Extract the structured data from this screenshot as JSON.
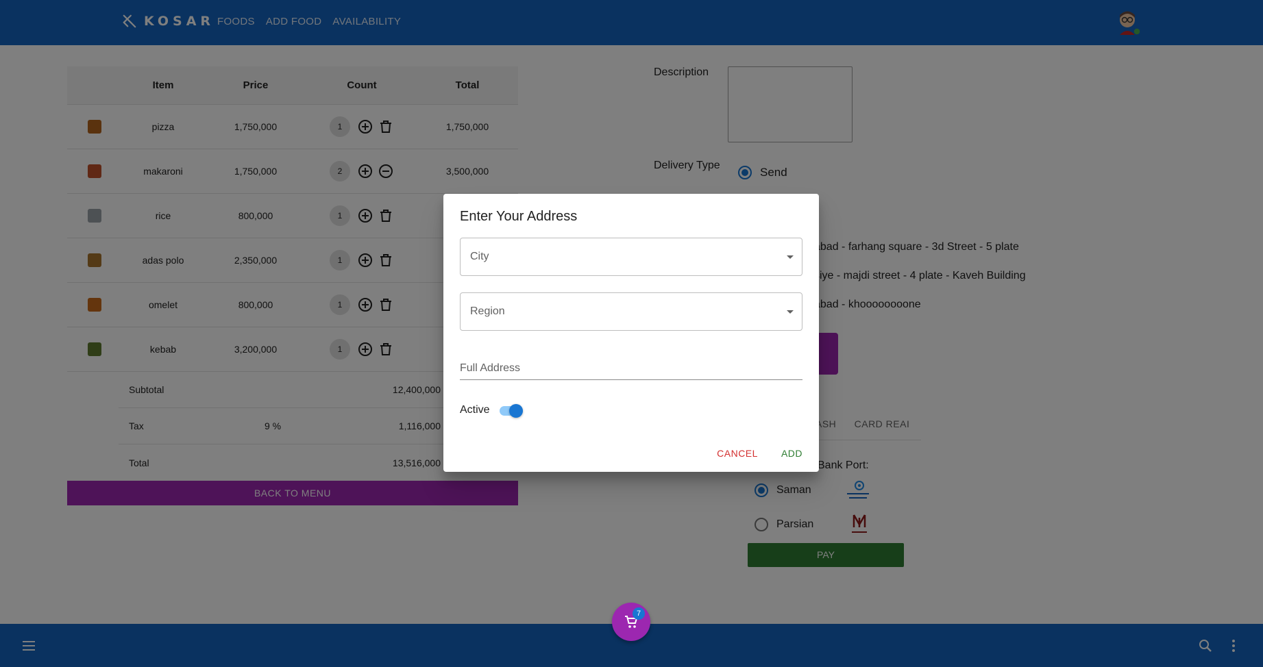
{
  "app": {
    "brand": "KOSAR",
    "nav": [
      "FOODS",
      "ADD FOOD",
      "AVAILABILITY"
    ]
  },
  "cart": {
    "headers": {
      "item": "Item",
      "price": "Price",
      "count": "Count",
      "total": "Total"
    },
    "rows": [
      {
        "item": "pizza",
        "price": "1,750,000",
        "count": "1",
        "total": "1,750,000",
        "thumb_color": "#b5651d",
        "second_action": "delete"
      },
      {
        "item": "makaroni",
        "price": "1,750,000",
        "count": "2",
        "total": "3,500,000",
        "thumb_color": "#c0502a",
        "second_action": "remove"
      },
      {
        "item": "rice",
        "price": "800,000",
        "count": "1",
        "total": "",
        "thumb_color": "#9aa3a8",
        "second_action": "delete"
      },
      {
        "item": "adas polo",
        "price": "2,350,000",
        "count": "1",
        "total": "",
        "thumb_color": "#a8742c",
        "second_action": "delete"
      },
      {
        "item": "omelet",
        "price": "800,000",
        "count": "1",
        "total": "",
        "thumb_color": "#c86a1a",
        "second_action": "delete"
      },
      {
        "item": "kebab",
        "price": "3,200,000",
        "count": "1",
        "total": "",
        "thumb_color": "#5e7a2e",
        "second_action": "delete"
      }
    ],
    "summary": {
      "subtotal_label": "Subtotal",
      "subtotal": "12,400,000",
      "tax_label": "Tax",
      "tax_rate": "9 %",
      "tax": "1,116,000",
      "total_label": "Total",
      "total": "13,516,000"
    },
    "back_button": "BACK TO MENU"
  },
  "order": {
    "description_label": "Description",
    "delivery_type_label": "Delivery Type",
    "delivery_option": "Send",
    "addresses": [
      "abad - farhang square - 3d Street - 5 plate",
      "siye - majdi street - 4 plate - Kaveh Building",
      "abad - khoooooooone"
    ],
    "payment_tabs": "ASH      CARD REAI",
    "bank_port_label": "Bank Port:",
    "banks": [
      {
        "name": "Saman",
        "selected": true
      },
      {
        "name": "Parsian",
        "selected": false
      }
    ],
    "pay_button": "PAY"
  },
  "dialog": {
    "title": "Enter Your Address",
    "city_label": "City",
    "region_label": "Region",
    "full_address_label": "Full Address",
    "active_label": "Active",
    "active_on": true,
    "cancel": "CANCEL",
    "add": "ADD"
  },
  "cart_badge": "7",
  "colors": {
    "primary": "#1565c0",
    "accent": "#9c27b0",
    "pay": "#2e7d32",
    "cancel": "#d32f2f",
    "switch": "#1976d2"
  },
  "icons": {
    "brand": "cutlery-icon",
    "menu": "hamburger-menu-icon",
    "search": "search-icon",
    "more": "more-vert-icon",
    "cart": "shopping-cart-icon"
  }
}
